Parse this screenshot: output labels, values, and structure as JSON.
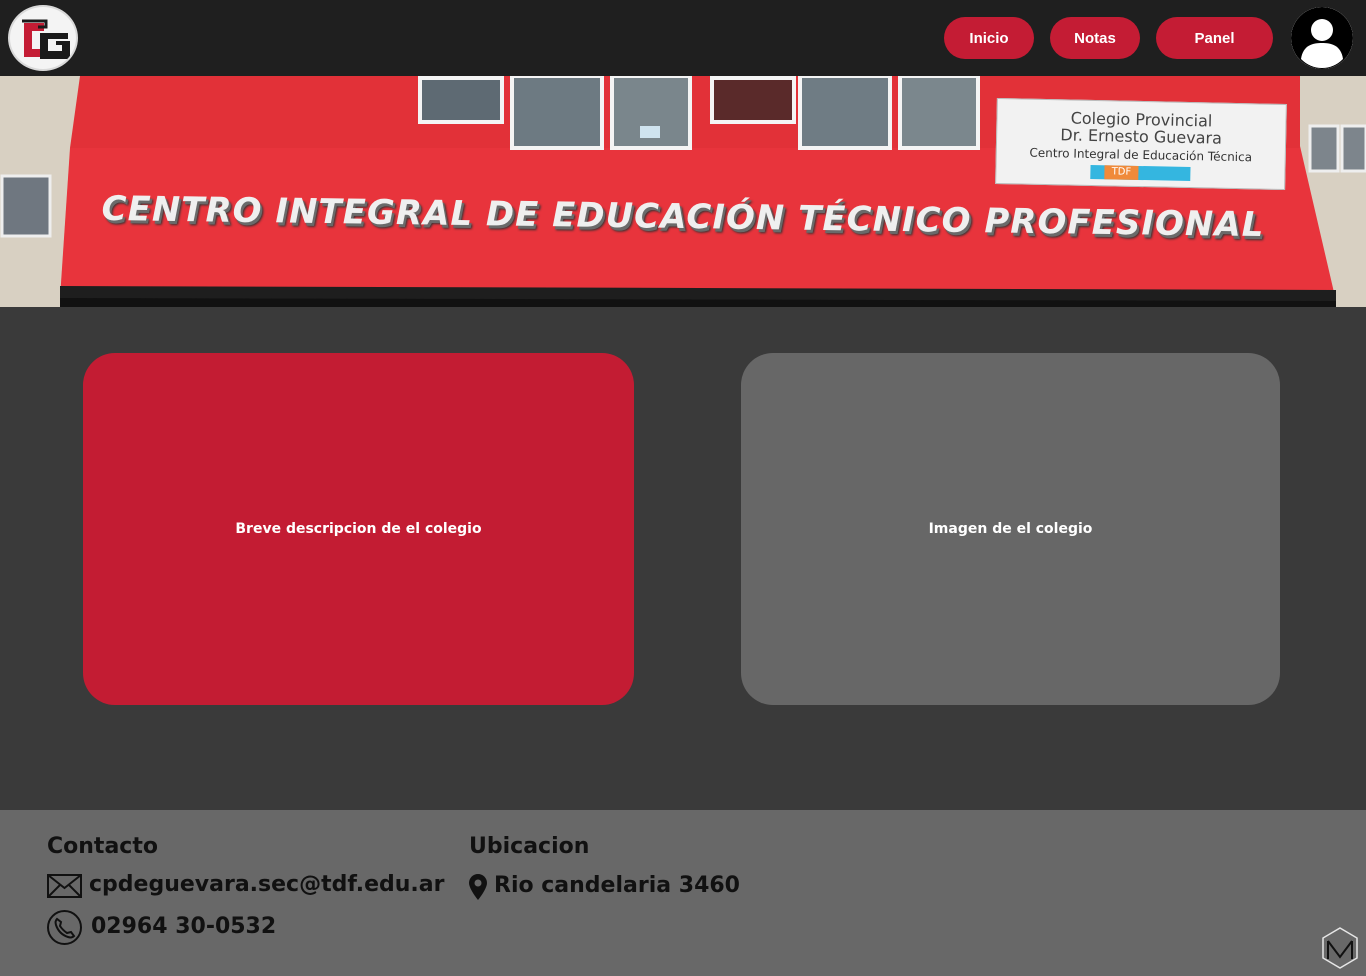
{
  "header": {
    "logo_alt": "CG",
    "nav": [
      {
        "label": "Inicio"
      },
      {
        "label": "Notas"
      },
      {
        "label": "Panel"
      }
    ],
    "avatar_icon": "user-avatar-icon"
  },
  "banner": {
    "headline": "CENTRO INTEGRAL DE EDUCACIÓN TÉCNICO PROFESIONAL",
    "plaque": {
      "line1": "Colegio Provincial",
      "line2": "Dr. Ernesto Guevara",
      "line3": "Centro Integral de Educación Técnica",
      "badge": "TDF"
    },
    "colors": {
      "facade": "#e8343c",
      "wall": "#cfc8bd"
    }
  },
  "main": {
    "description_card": {
      "label": "Breve descripcion de el colegio",
      "color": "#c31c33"
    },
    "image_card": {
      "label": "Imagen de el colegio",
      "color": "#676767"
    }
  },
  "footer": {
    "contact": {
      "heading": "Contacto",
      "email": "cpdeguevara.sec@tdf.edu.ar",
      "phone": "02964 30-0532"
    },
    "location": {
      "heading": "Ubicacion",
      "address": "Rio candelaria 3460"
    }
  },
  "colors": {
    "accent": "#c41c34",
    "topbar": "#1f1f1f",
    "body": "#3a3a3a",
    "footer": "#686868"
  }
}
